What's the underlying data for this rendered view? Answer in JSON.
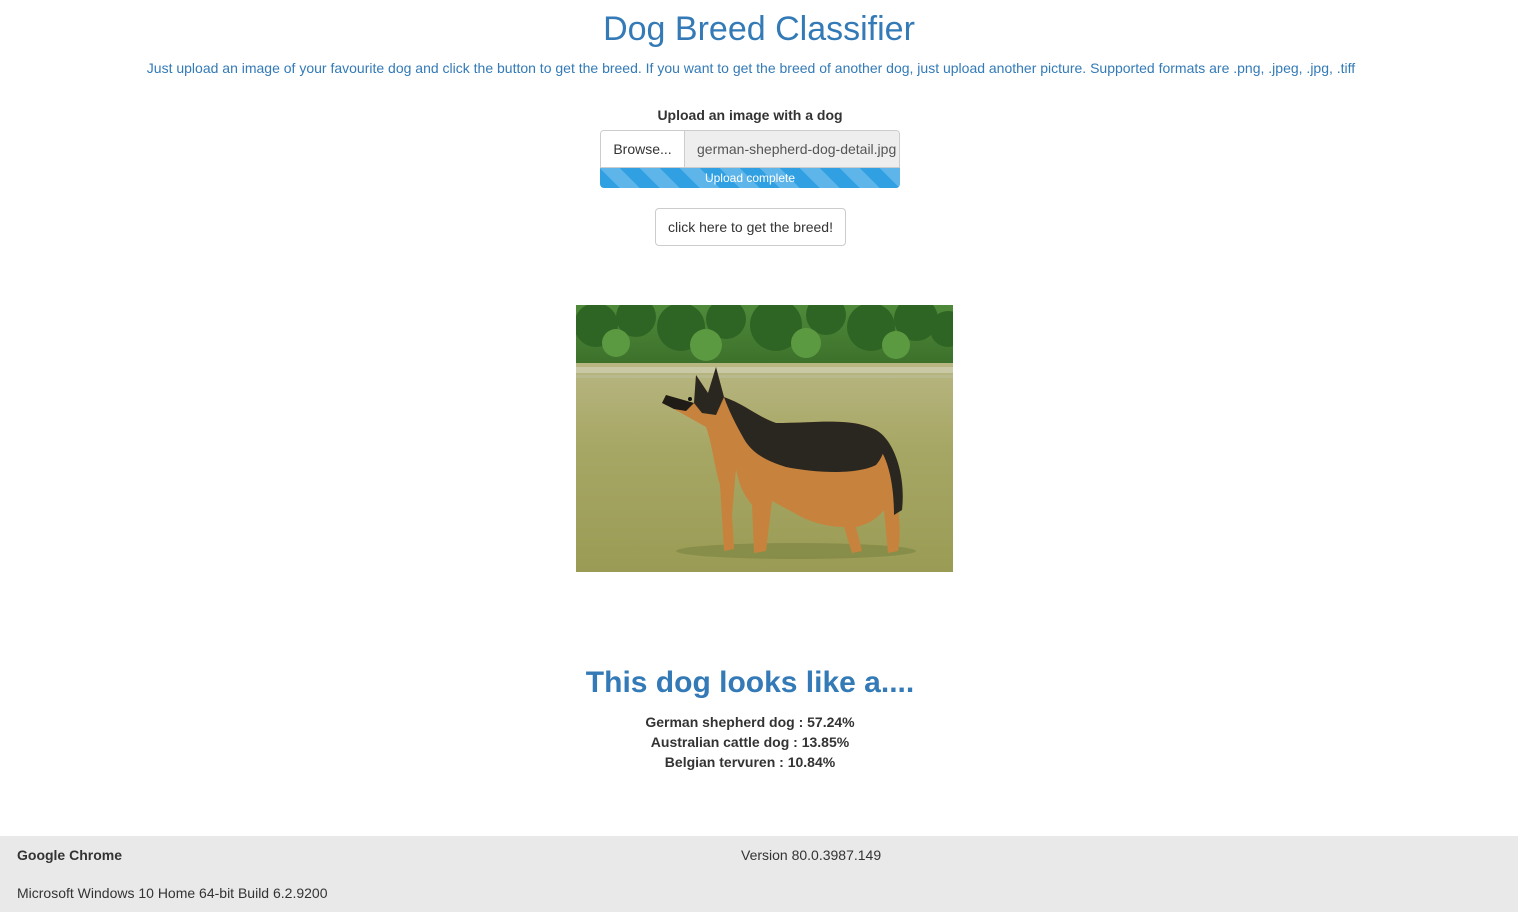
{
  "header": {
    "title": "Dog Breed Classifier",
    "subtitle": "Just upload an image of your favourite dog and click the button to get the breed. If you want to get the breed of another dog, just upload another picture. Supported formats are .png, .jpeg, .jpg, .tiff"
  },
  "upload": {
    "label": "Upload an image with a dog",
    "browse_label": "Browse...",
    "file_name": "german-shepherd-dog-detail.jpg",
    "progress_text": "Upload complete",
    "progress_percent": 100
  },
  "action": {
    "predict_label": "click here to get the breed!"
  },
  "image": {
    "icon": "dog-photo",
    "colors": {
      "grass": "#a9a85e",
      "trees": "#3f7a2e",
      "dog_tan": "#c7833d",
      "dog_black": "#2a2620"
    }
  },
  "results": {
    "heading": "This dog looks like a....",
    "predictions": [
      "German shepherd dog : 57.24%",
      "Australian cattle dog : 13.85%",
      "Belgian tervuren : 10.84%"
    ]
  },
  "footer": {
    "browser_name": "Google Chrome",
    "browser_version": "Version 80.0.3987.149",
    "os_info": "Microsoft Windows 10 Home 64-bit Build 6.2.9200"
  },
  "theme": {
    "accent": "#337ab7",
    "progress": "#31a0e3",
    "footer_bg": "#e9e9e9"
  }
}
